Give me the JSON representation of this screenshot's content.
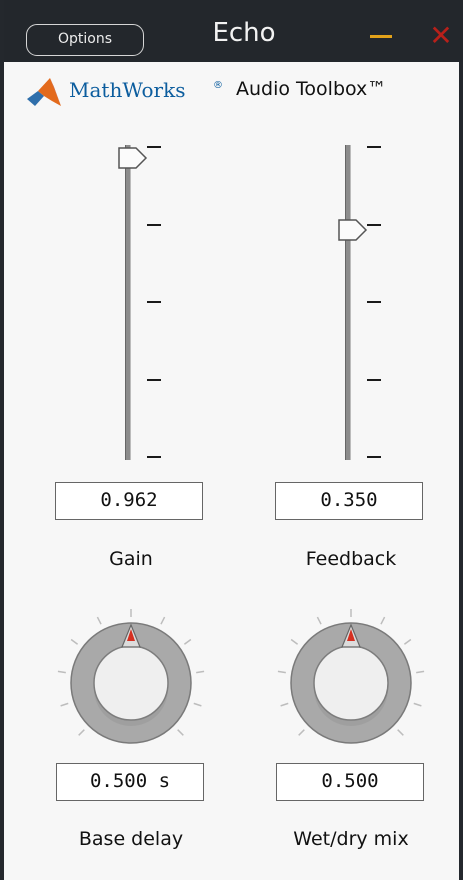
{
  "window": {
    "title": "Echo",
    "options_label": "Options",
    "minimize_icon": "minimize-icon",
    "close_icon": "close-icon",
    "close_glyph": "✕",
    "colors": {
      "titlebar": "#23272c",
      "minimize": "#e3a21a",
      "close": "#b7201a"
    }
  },
  "brand": {
    "logo_icon": "mathworks-logo-icon",
    "name": "MathWorks",
    "mark": "®",
    "product": "Audio Toolbox™",
    "colors": {
      "name": "#0c5d9e"
    }
  },
  "controls": {
    "gain": {
      "value": "0.962",
      "label": "Gain",
      "level": 0.962
    },
    "feedback": {
      "value": "0.350",
      "label": "Feedback",
      "level": 0.73
    },
    "base_delay": {
      "value": "0.500 s",
      "label": "Base delay",
      "level": 0.5
    },
    "wet_dry_mix": {
      "value": "0.500",
      "label": "Wet/dry mix",
      "level": 0.5
    }
  }
}
